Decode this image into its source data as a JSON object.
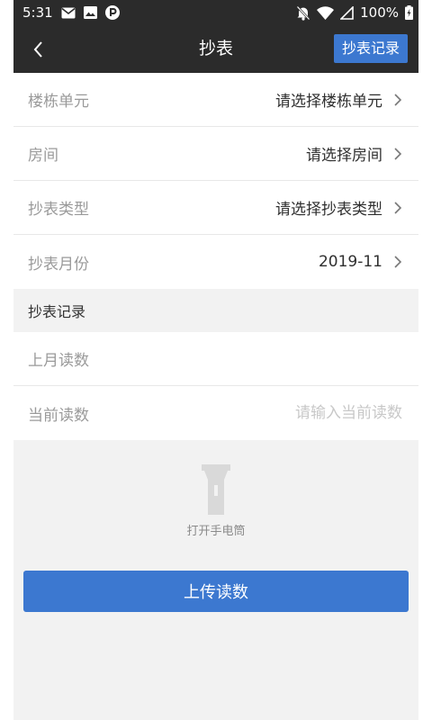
{
  "status_bar": {
    "time": "5:31",
    "battery": "100%"
  },
  "header": {
    "title": "抄表",
    "records_button": "抄表记录"
  },
  "form": {
    "rows": [
      {
        "label": "楼栋单元",
        "value": "请选择楼栋单元"
      },
      {
        "label": "房间",
        "value": "请选择房间"
      },
      {
        "label": "抄表类型",
        "value": "请选择抄表类型"
      },
      {
        "label": "抄表月份",
        "value": "2019-11"
      }
    ],
    "section_title": "抄表记录",
    "last_month_label": "上月读数",
    "current_label": "当前读数",
    "current_placeholder": "请输入当前读数"
  },
  "flashlight_label": "打开手电筒",
  "upload_button": "上传读数",
  "colors": {
    "bar": "#2b2b2b",
    "accent": "#3c78d0"
  }
}
